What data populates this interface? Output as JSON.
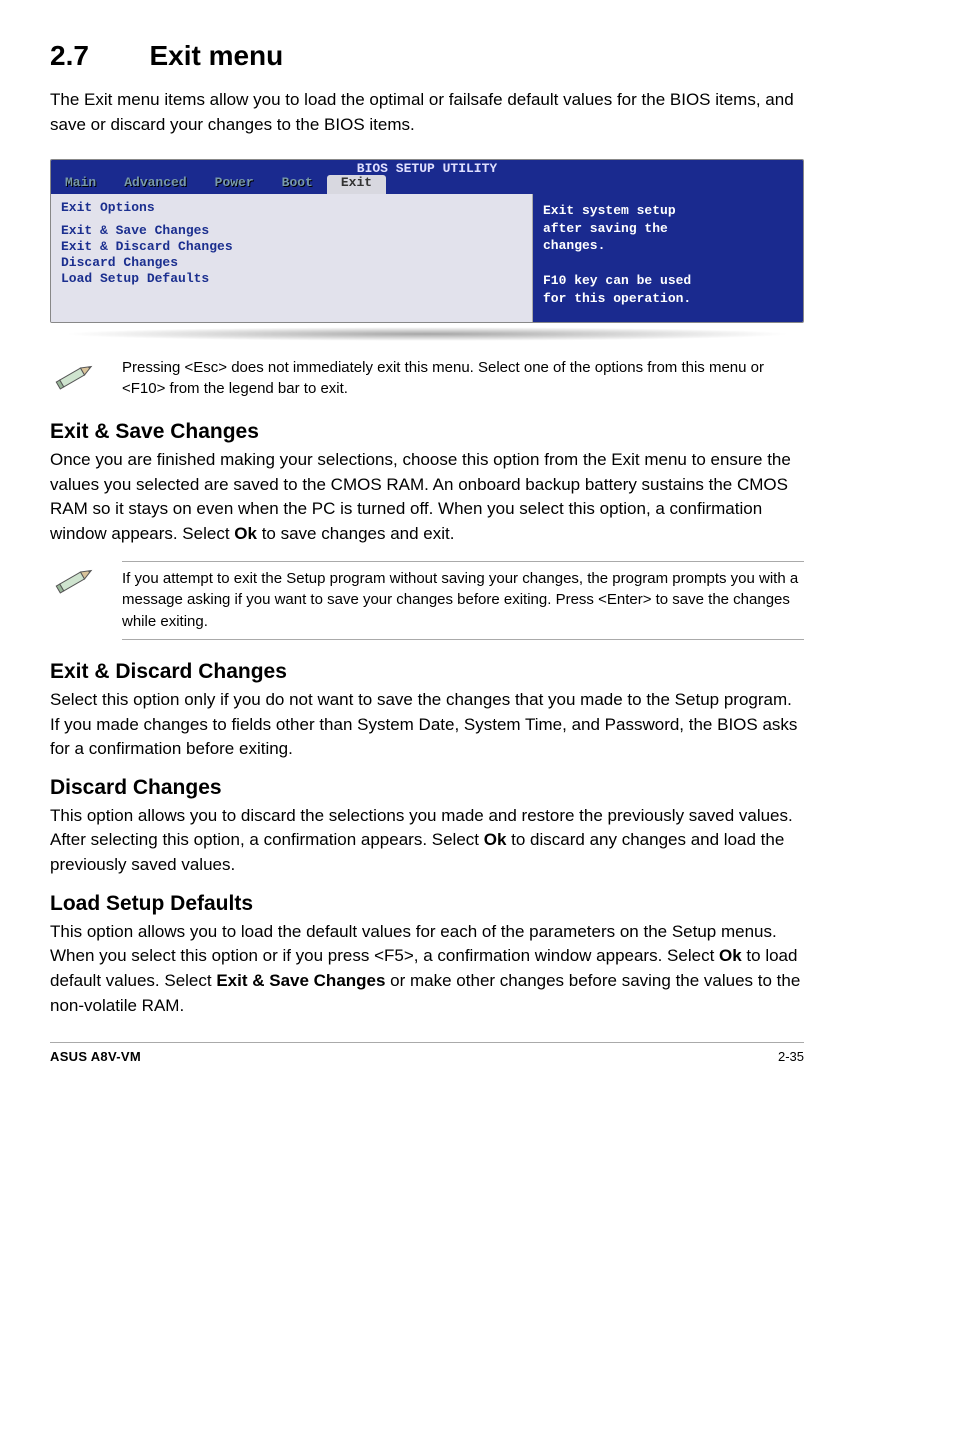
{
  "heading": {
    "num": "2.7",
    "title": "Exit menu"
  },
  "intro": "The Exit menu items allow you to load the optimal or failsafe default values for the BIOS items, and save or discard your changes to the BIOS items.",
  "bios": {
    "title": "BIOS SETUP UTILITY",
    "tabs": [
      "Main",
      "Advanced",
      "Power",
      "Boot",
      "Exit"
    ],
    "activeTab": 4,
    "leftHeading": "Exit Options",
    "items": [
      "Exit & Save Changes",
      "Exit & Discard Changes",
      "Discard Changes",
      "",
      "Load Setup Defaults"
    ],
    "rightLines": [
      "Exit system setup",
      "after saving the",
      "changes.",
      "",
      "F10 key can be used",
      "for this operation."
    ]
  },
  "note1": "Pressing <Esc> does not immediately exit this menu. Select one of the options from this menu or <F10> from the legend bar to exit.",
  "sections": {
    "exitSave": {
      "title": "Exit & Save Changes",
      "body_pre": "Once you are finished making your selections, choose this option from the Exit menu to ensure the values you selected are saved to the CMOS RAM. An onboard backup battery sustains the CMOS RAM so it stays on even when the PC is turned off. When you select this option, a confirmation window appears. Select ",
      "bold1": "Ok",
      "body_post": " to save changes and exit."
    },
    "exitSaveNote": "If you attempt to exit the Setup program without saving your changes, the program prompts you with a message asking if you want to save your changes before exiting. Press <Enter>  to save the  changes while exiting.",
    "exitDiscard": {
      "title": "Exit & Discard Changes",
      "body": "Select this option only if you do not want to save the changes that you made to the Setup program. If you made changes to fields other than System Date, System Time, and Password, the BIOS asks for a confirmation before exiting."
    },
    "discard": {
      "title": "Discard Changes",
      "body_pre": "This option allows you to discard the selections you made and restore the previously saved values. After selecting this option, a confirmation appears. Select ",
      "bold1": "Ok",
      "body_post": " to discard any changes and load the previously saved values."
    },
    "loadDefaults": {
      "title": "Load Setup Defaults",
      "body1": "This option allows you to load the default values for each of the parameters on the Setup menus. When you select this option or if you press <F5>, a confirmation window appears. Select ",
      "bold1": "Ok",
      "body2": " to load default values. Select ",
      "bold2": "Exit & Save Changes",
      "body3": " or make other changes before saving the values to the non-volatile RAM."
    }
  },
  "footer": {
    "left": "ASUS A8V-VM",
    "right": "2-35"
  }
}
